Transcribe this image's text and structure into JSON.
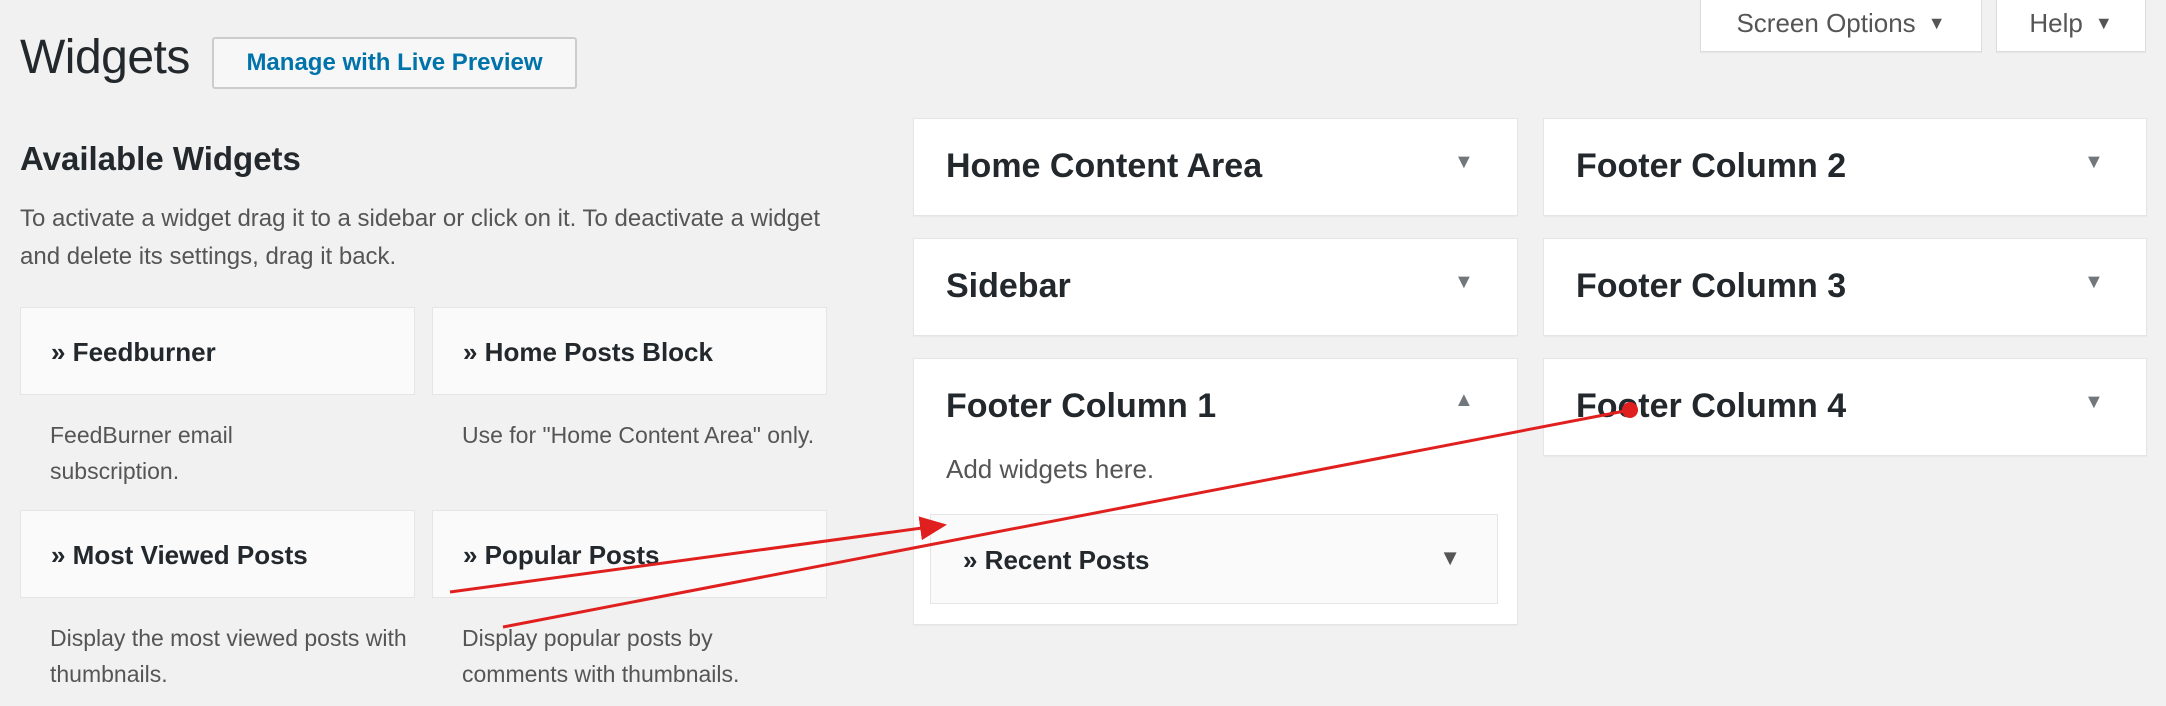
{
  "header": {
    "title": "Widgets",
    "live_preview_label": "Manage with Live Preview",
    "screen_options_label": "Screen Options",
    "help_label": "Help"
  },
  "available": {
    "title": "Available Widgets",
    "description": "To activate a widget drag it to a sidebar or click on it. To deactivate a widget and delete its settings, drag it back.",
    "widgets": [
      {
        "title": "» Feedburner",
        "description": "FeedBurner email subscription."
      },
      {
        "title": "» Home Posts Block",
        "description": "Use for \"Home Content Area\" only."
      },
      {
        "title": "» Most Viewed Posts",
        "description": "Display the most viewed posts with thumbnails."
      },
      {
        "title": "» Popular Posts",
        "description": "Display popular posts by comments with thumbnails."
      }
    ]
  },
  "sidebars": [
    {
      "title": "Home Content Area"
    },
    {
      "title": "Footer Column 2"
    },
    {
      "title": "Sidebar"
    },
    {
      "title": "Footer Column 3"
    },
    {
      "title": "Footer Column 1",
      "empty_text": "Add widgets here.",
      "widget": "» Recent Posts"
    },
    {
      "title": "Footer Column 4"
    }
  ],
  "icons": {
    "collapse": "triangle-down-icon",
    "expand": "triangle-up-icon"
  },
  "colors": {
    "link": "#0073aa",
    "annotation_arrow": "#e0201e"
  }
}
